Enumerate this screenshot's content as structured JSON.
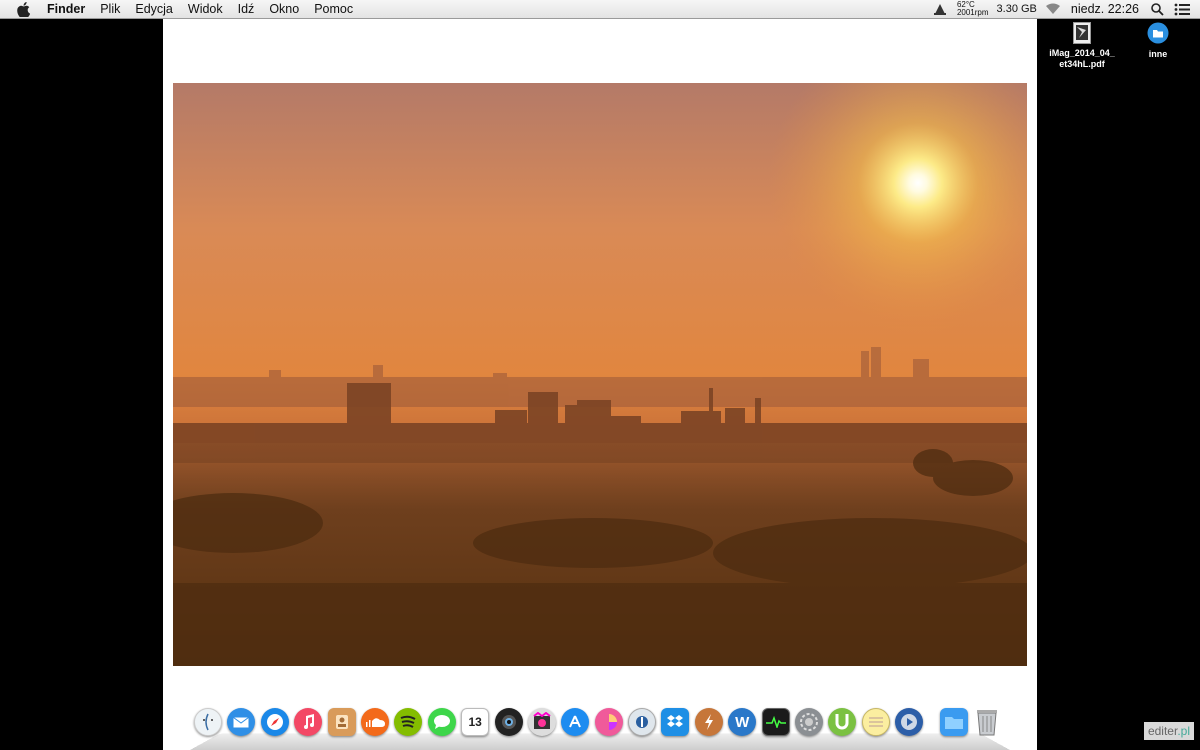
{
  "menubar": {
    "app_name": "Finder",
    "items": [
      "Plik",
      "Edycja",
      "Widok",
      "Idź",
      "Okno",
      "Pomoc"
    ],
    "temp": "62°C",
    "rpm": "2001rpm",
    "memory": "3.30 GB",
    "clock": "niedz. 22:26"
  },
  "desktop": {
    "file1": "iMag_2014_04_\net34hL.pdf",
    "file1_line1": "iMag_2014_04_",
    "file1_line2": "et34hL.pdf",
    "folder1": "inne"
  },
  "dock": {
    "items": [
      "finder-icon",
      "mail-icon",
      "safari-icon",
      "itunes-icon",
      "contacts-icon",
      "soundcloud-icon",
      "spotify-icon",
      "messages-icon",
      "calendar-icon",
      "photo-booth-icon",
      "final-cut-icon",
      "app-store-icon",
      "pinwheel-icon",
      "1password-icon",
      "dropbox-icon",
      "flux-icon",
      "word-icon",
      "activity-monitor-icon",
      "system-preferences-icon",
      "utorrent-icon",
      "notes-icon",
      "quicktime-icon",
      "downloads-folder-icon",
      "trash-icon"
    ],
    "calendar_day": "13"
  },
  "colors": {
    "sky_top": "#b8806a",
    "sky_mid": "#e49a4f",
    "haze": "#c77439",
    "ground": "#6b3e1a"
  },
  "watermark": {
    "text1": "editer",
    "text2": ".pl"
  }
}
